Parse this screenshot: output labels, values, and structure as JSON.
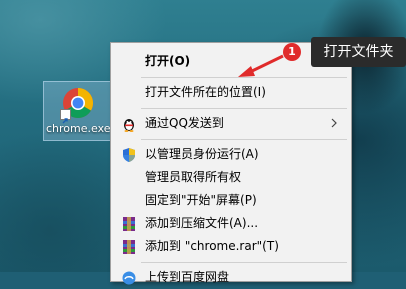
{
  "desktop": {
    "icon_label": "chrome.exe"
  },
  "context_menu": {
    "items": [
      {
        "label": "打开(O)",
        "bold": true
      },
      {
        "label": "打开文件所在的位置(I)"
      },
      {
        "label": "通过QQ发送到",
        "icon": "qq-icon",
        "submenu": true
      },
      {
        "label": "以管理员身份运行(A)",
        "icon": "uac-shield-icon"
      },
      {
        "label": "管理员取得所有权"
      },
      {
        "label": "固定到\"开始\"屏幕(P)"
      },
      {
        "label": "添加到压缩文件(A)...",
        "icon": "winrar-icon"
      },
      {
        "label": "添加到 \"chrome.rar\"(T)",
        "icon": "winrar-icon"
      },
      {
        "label": "上传到百度网盘",
        "icon": "baidu-netdisk-icon"
      }
    ]
  },
  "annotation": {
    "badge_number": "1",
    "callout_text": "打开文件夹"
  },
  "colors": {
    "badge": "#e02b2b",
    "arrow": "#e02b2b",
    "callout_bg": "#2b2b2b"
  }
}
